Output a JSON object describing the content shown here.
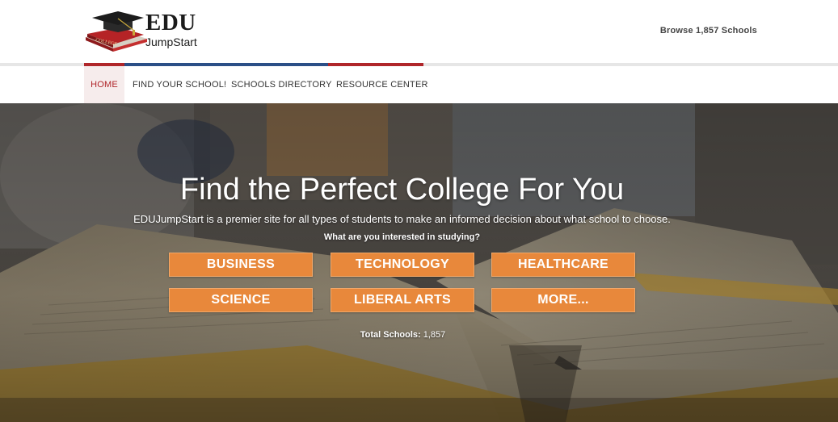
{
  "logo": {
    "brand_top": "EDU",
    "brand_bottom": "JumpStart",
    "book_label": "COLLEGE"
  },
  "header": {
    "browse_link": "Browse 1,857 Schools"
  },
  "nav": {
    "items": [
      {
        "label": "HOME",
        "active": true
      },
      {
        "label": "FIND YOUR SCHOOL!"
      },
      {
        "label": "SCHOOLS DIRECTORY"
      },
      {
        "label": "RESOURCE CENTER"
      }
    ]
  },
  "hero": {
    "title": "Find the Perfect College For You",
    "subtitle": "EDUJumpStart is a premier site for all types of students to make an informed decision about what school to choose.",
    "question": "What are you interested in studying?",
    "categories": [
      "BUSINESS",
      "TECHNOLOGY",
      "HEALTHCARE",
      "SCIENCE",
      "LIBERAL ARTS",
      "MORE..."
    ],
    "total_label": "Total Schools:",
    "total_value": "1,857"
  },
  "colors": {
    "accent_red": "#b0262a",
    "accent_blue": "#2b4f87",
    "button_orange": "#e8883b"
  }
}
